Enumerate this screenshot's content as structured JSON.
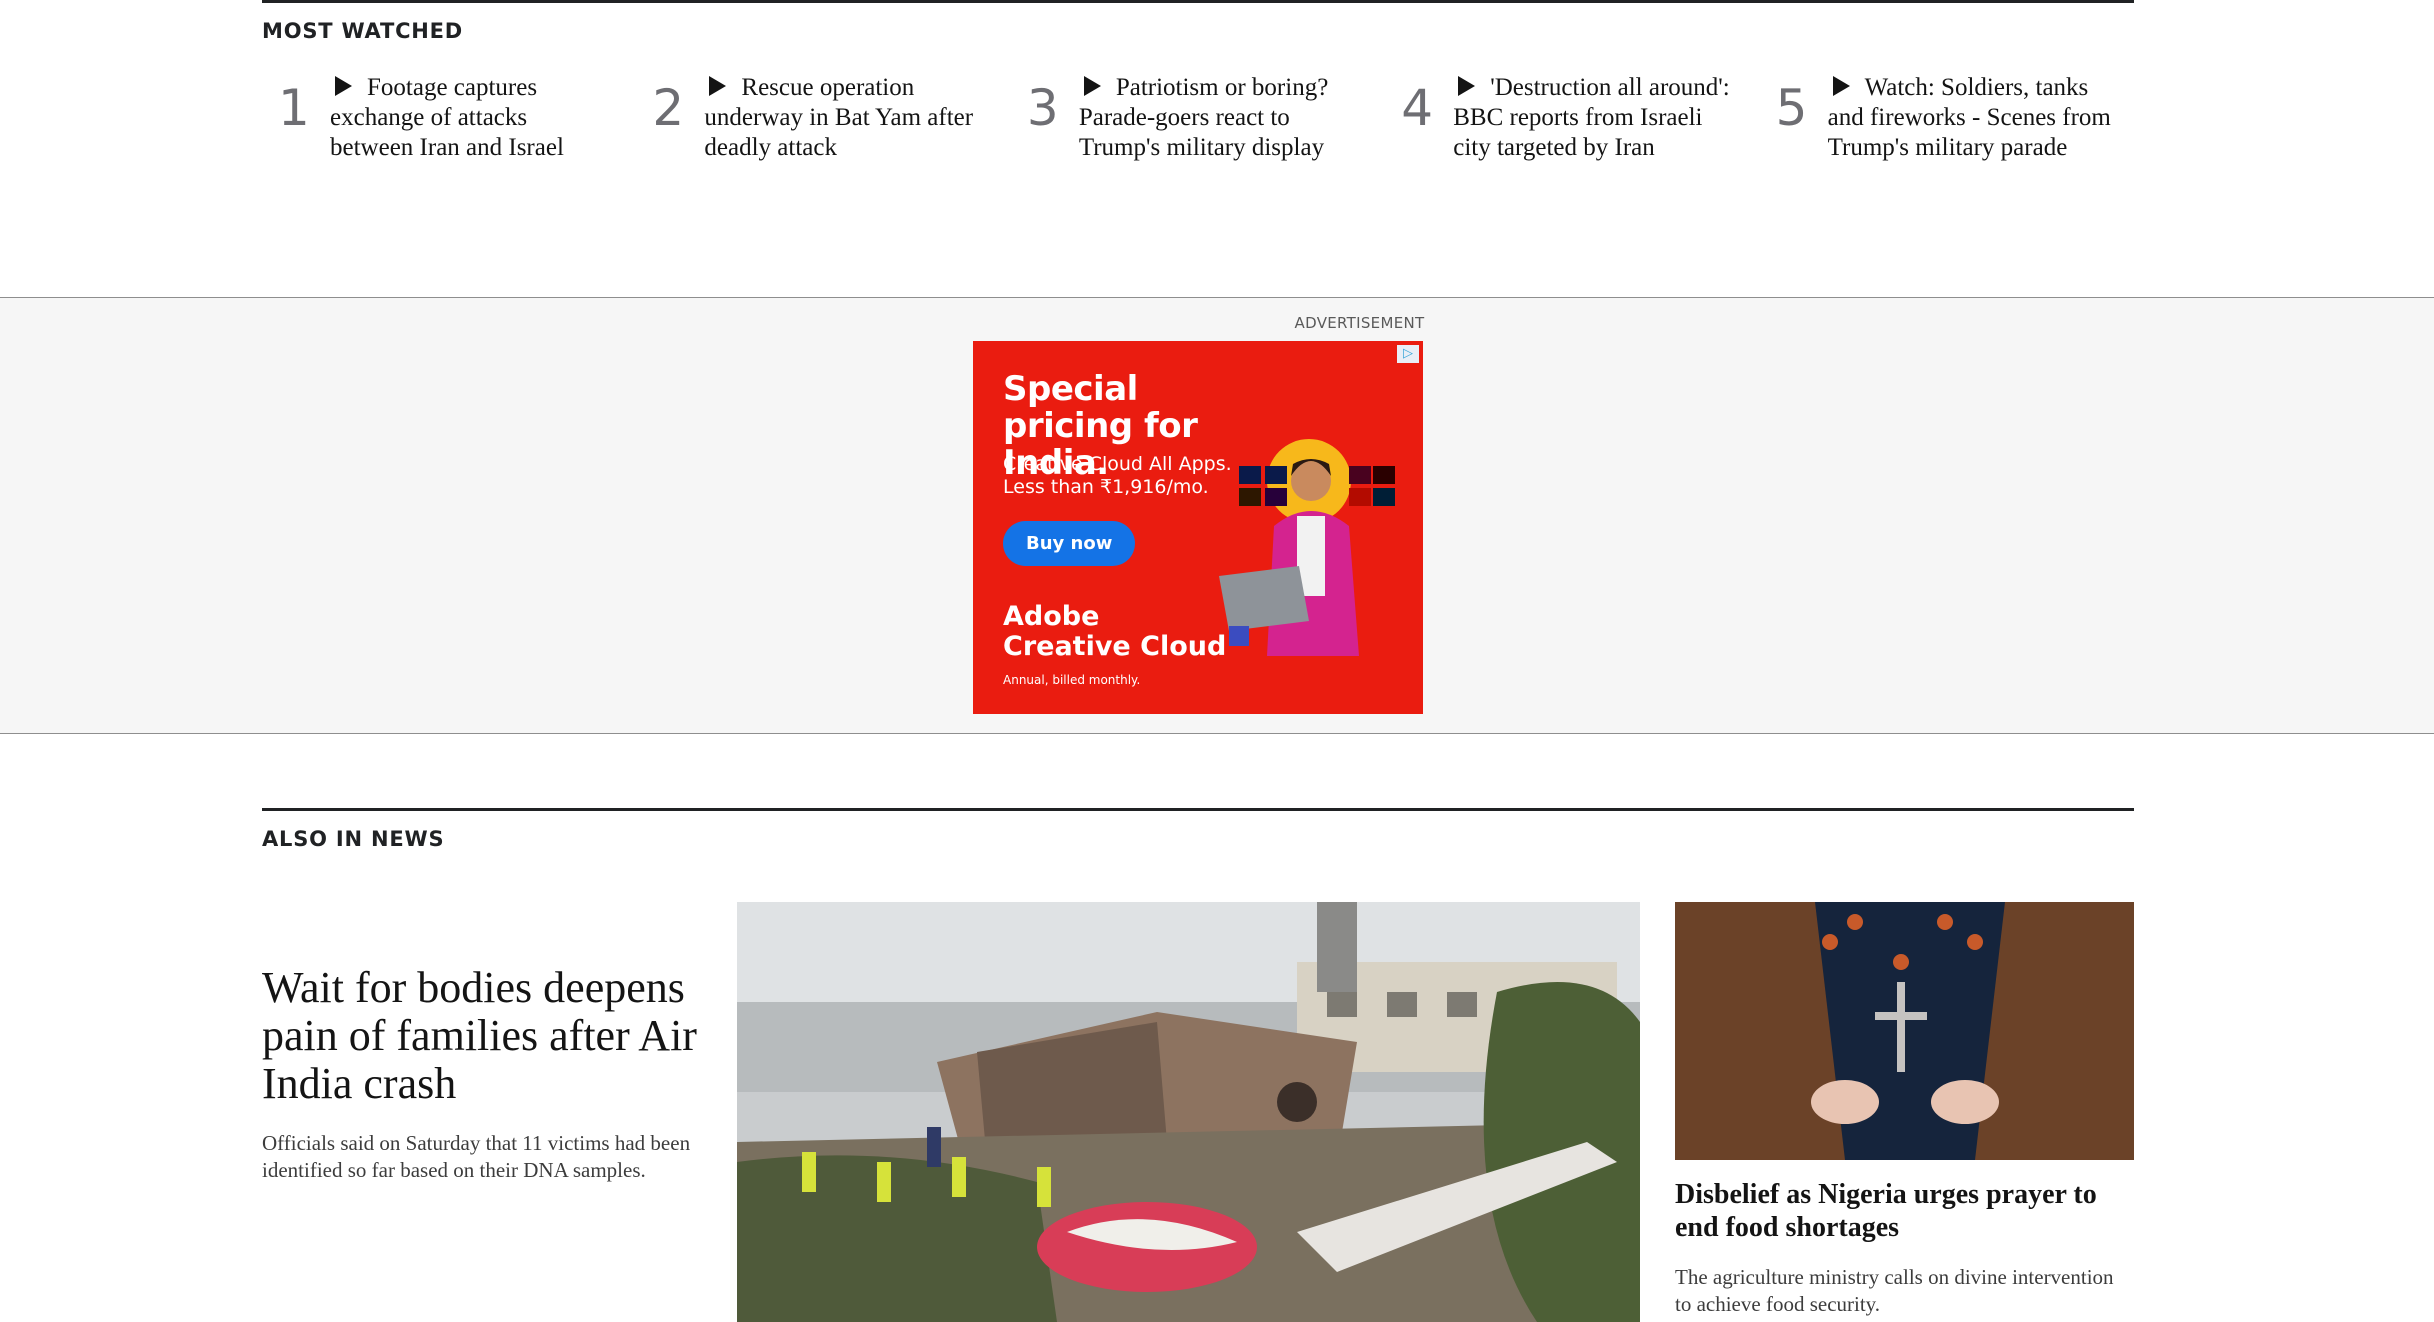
{
  "most_watched": {
    "heading": "MOST WATCHED",
    "items": [
      {
        "rank": "1",
        "title": "Footage captures exchange of attacks between Iran and Israel"
      },
      {
        "rank": "2",
        "title": "Rescue operation underway in Bat Yam after deadly attack"
      },
      {
        "rank": "3",
        "title": "Patriotism or boring? Parade-goers react to Trump's military display"
      },
      {
        "rank": "4",
        "title": "'Destruction all around': BBC reports from Israeli city targeted by Iran"
      },
      {
        "rank": "5",
        "title": "Watch: Soldiers, tanks and fireworks - Scenes from Trump's military parade"
      }
    ]
  },
  "advertisement": {
    "label": "ADVERTISEMENT",
    "headline": "Special pricing for India.",
    "subline": "Creative Cloud All Apps. Less than ₹1,916/mo.",
    "button": "Buy now",
    "brand_line1": "Adobe",
    "brand_line2": "Creative Cloud",
    "fine_print": "Annual, billed monthly.",
    "choice_icon": "▷",
    "colors": {
      "background": "#ea1c10",
      "button": "#1473e6"
    }
  },
  "also_in_news": {
    "heading": "ALSO IN NEWS",
    "lead": {
      "title": "Wait for bodies deepens pain of families after Air India crash",
      "summary": "Officials said on Saturday that 11 victims had been identified so far based on their DNA samples."
    },
    "side": {
      "title": "Disbelief as Nigeria urges prayer to end food shortages",
      "summary": "The agriculture ministry calls on divine intervention to achieve food security."
    }
  }
}
